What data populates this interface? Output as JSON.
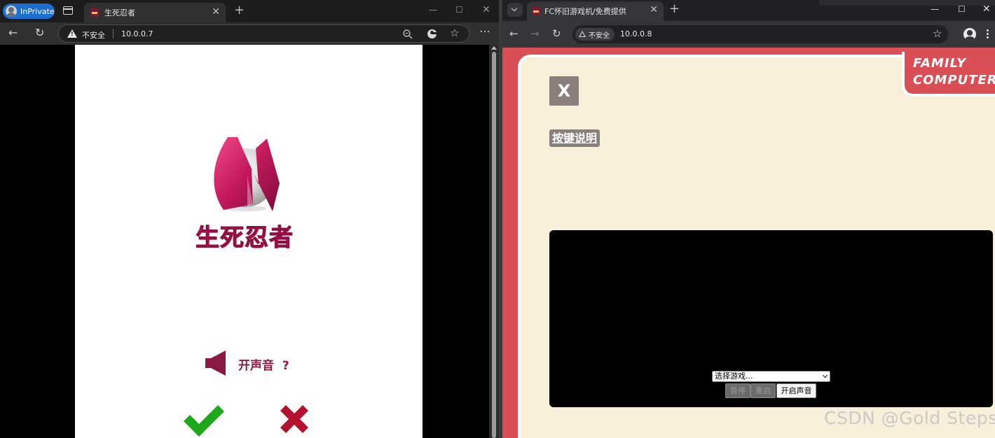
{
  "left_browser": {
    "inprivate_label": "InPrivate",
    "tab_title": "生死忍者",
    "security_label": "不安全",
    "url": "10.0.0.7",
    "page": {
      "game_title": "生死忍者",
      "sound_prompt": "开声音",
      "sound_prompt_mark": "?"
    }
  },
  "right_browser": {
    "tab_title": "FC怀旧游戏机/免费提供",
    "security_label": "不安全",
    "url": "10.0.0.8",
    "page": {
      "brand_line1": "FAMILY",
      "brand_line2": "COMPUTER",
      "close_label": "X",
      "keys_help_label": "按键说明",
      "game_select_value": "选择游戏...",
      "pause_label": "暂停",
      "restart_label": "重启",
      "sound_label": "开启声音"
    }
  },
  "watermark": "CSDN @Gold Steps.",
  "colors": {
    "accent_crimson": "#c2185b",
    "fc_red": "#d94f55",
    "fc_cream": "#f7efda",
    "check_green": "#1ea81e",
    "cross_red": "#b3112e"
  }
}
